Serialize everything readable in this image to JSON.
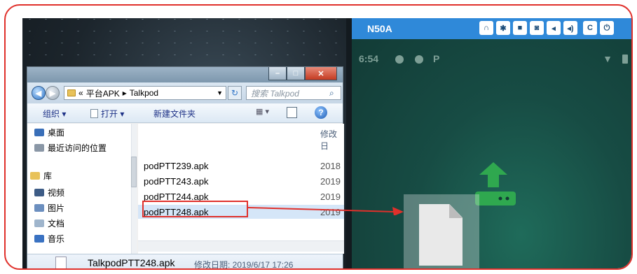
{
  "explorer": {
    "address": {
      "prefix": "«",
      "path": [
        "平台APK",
        "Talkpod"
      ]
    },
    "search_placeholder": "搜索 Talkpod",
    "toolbar": {
      "organize": "组织 ▾",
      "open": "打开 ▾",
      "new_folder": "新建文件夹"
    },
    "nav_items": [
      {
        "label": "桌面",
        "icon": "desktop-icon"
      },
      {
        "label": "最近访问的位置",
        "icon": "recent-places-icon"
      },
      {
        "label": "库",
        "icon": "library-icon"
      },
      {
        "label": "视频",
        "icon": "videos-icon"
      },
      {
        "label": "图片",
        "icon": "pictures-icon"
      },
      {
        "label": "文档",
        "icon": "documents-icon"
      },
      {
        "label": "音乐",
        "icon": "music-icon"
      }
    ],
    "column_header": "修改日",
    "files": [
      {
        "name": "podPTT239.apk",
        "date": "2018"
      },
      {
        "name": "podPTT243.apk",
        "date": "2019"
      },
      {
        "name": "podPTT244.apk",
        "date": "2019"
      },
      {
        "name": "podPTT248.apk",
        "date": "2019"
      }
    ],
    "details": {
      "name": "TalkpodPTT248.apk",
      "meta": "修改日期: 2019/6/17 17:26"
    }
  },
  "device": {
    "title": "N50A",
    "toolbar_icons": [
      "headset-icon",
      "settings-icon",
      "record-icon",
      "camera-icon",
      "volume-down-icon",
      "volume-up-icon",
      "rotate-icon",
      "power-icon"
    ],
    "status": {
      "time": "6:54",
      "p": "P"
    }
  },
  "colors": {
    "annotation": "#e0302b",
    "scrcpy_bar": "#2f89d9",
    "install_icon": "#2fa84f"
  }
}
